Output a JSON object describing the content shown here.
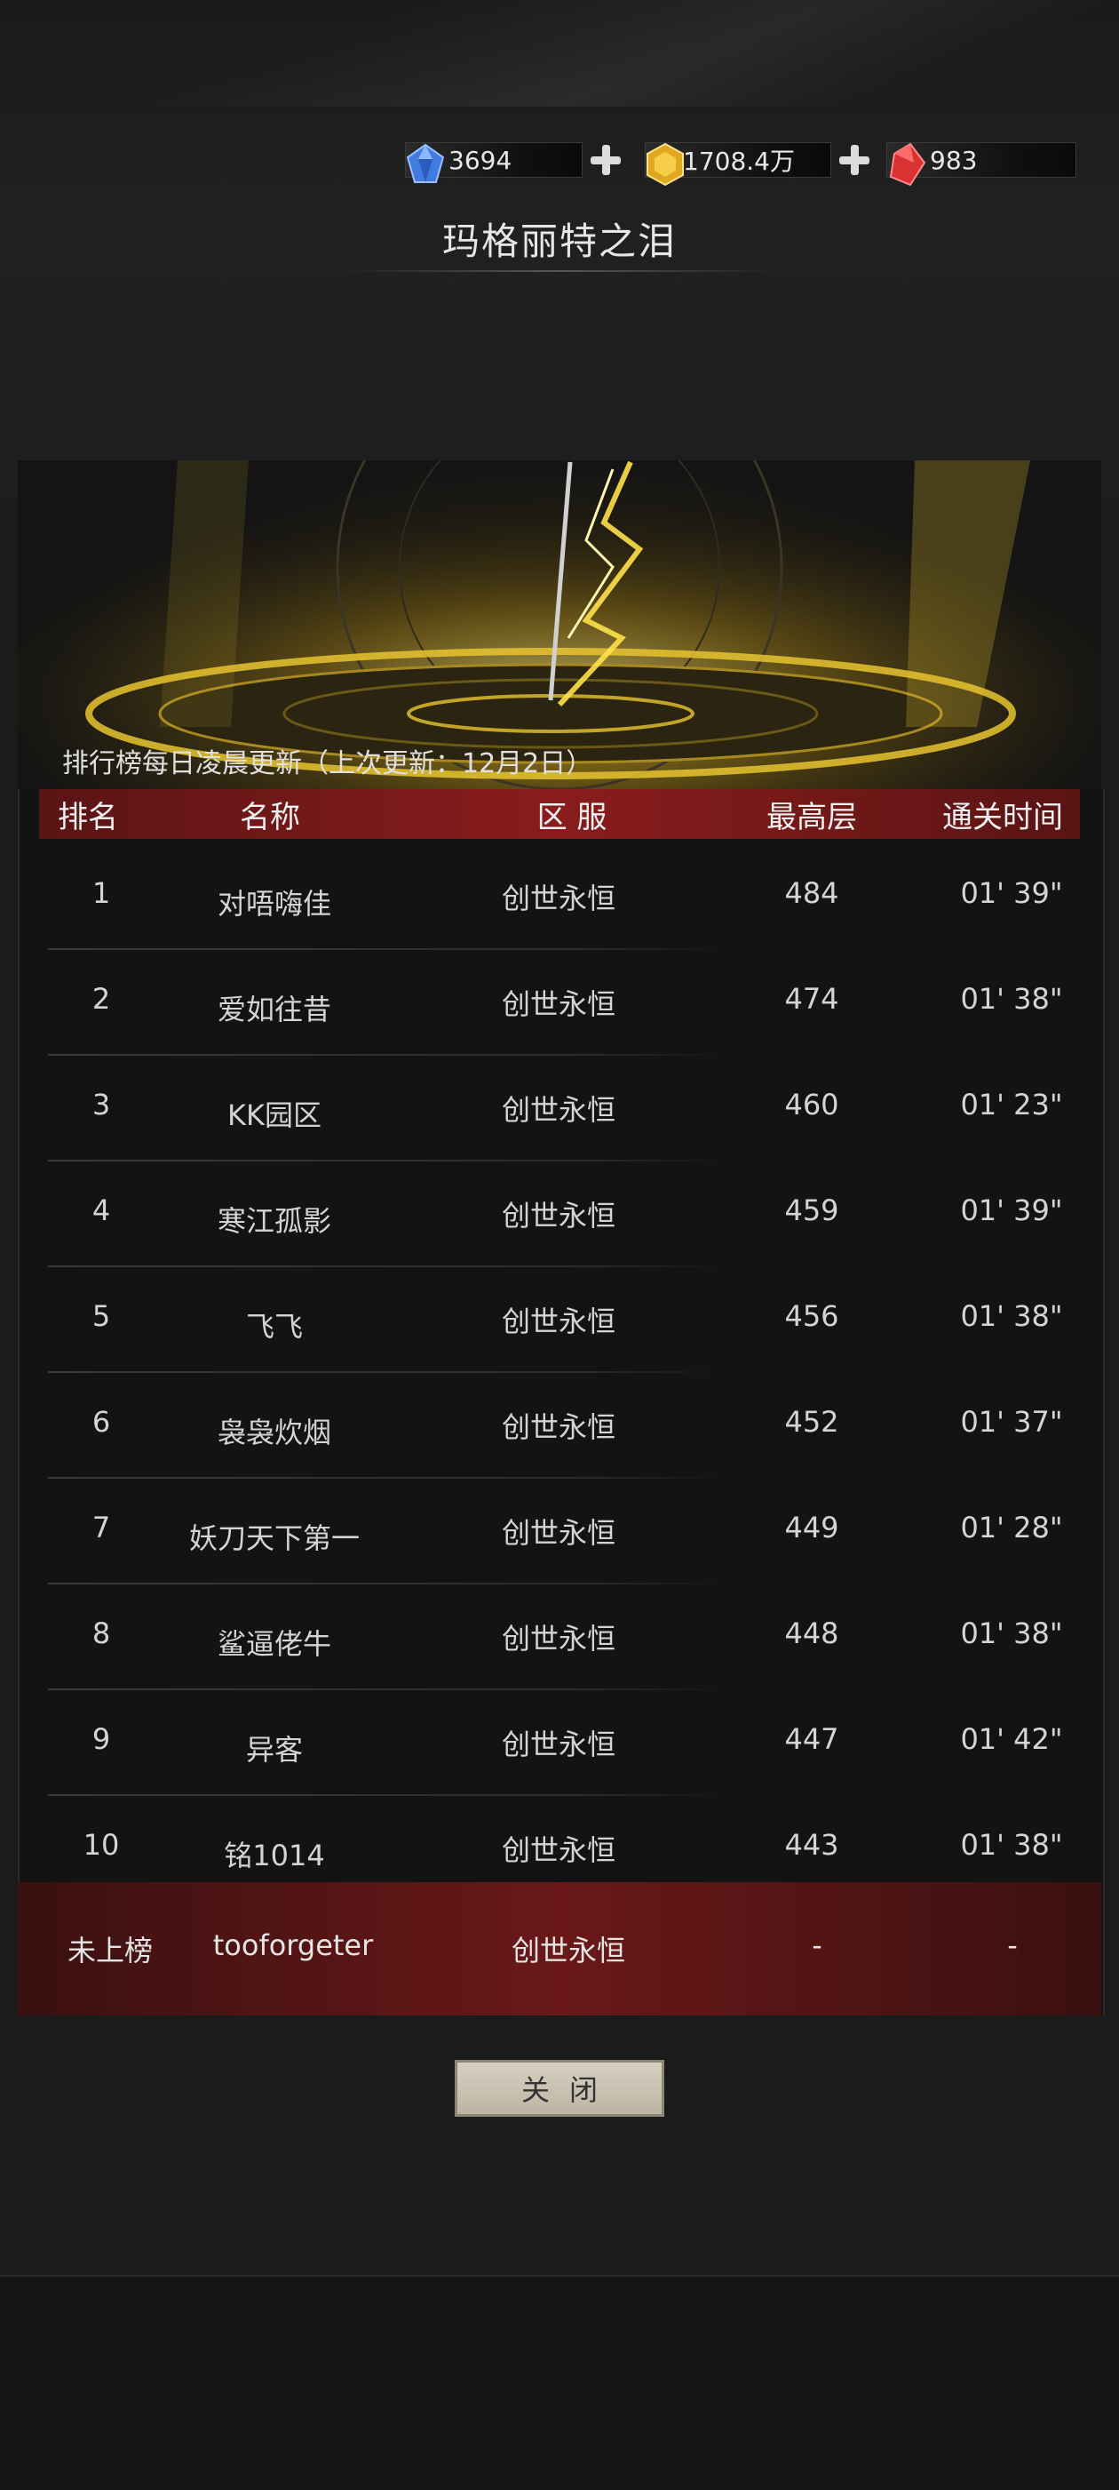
{
  "currencies": [
    {
      "icon": "blue-diamond-icon",
      "value": "3694",
      "color": "#3f7be0"
    },
    {
      "icon": "gold-coin-icon",
      "value": "1708.4万",
      "color": "#e0a820"
    },
    {
      "icon": "red-gem-icon",
      "value": "983",
      "color": "#d83232"
    }
  ],
  "title": "玛格丽特之泪",
  "update_note": "排行榜每日凌晨更新（上次更新：12月2日）",
  "columns": [
    "排名",
    "名称",
    "区 服",
    "最高层",
    "通关时间"
  ],
  "rows": [
    {
      "rank": "1",
      "name": "对唔嗨佳",
      "server": "创世永恒",
      "floor": "484",
      "time": "01' 39\""
    },
    {
      "rank": "2",
      "name": "爱如往昔",
      "server": "创世永恒",
      "floor": "474",
      "time": "01' 38\""
    },
    {
      "rank": "3",
      "name": "KK园区",
      "server": "创世永恒",
      "floor": "460",
      "time": "01' 23\""
    },
    {
      "rank": "4",
      "name": "寒江孤影",
      "server": "创世永恒",
      "floor": "459",
      "time": "01' 39\""
    },
    {
      "rank": "5",
      "name": "飞飞",
      "server": "创世永恒",
      "floor": "456",
      "time": "01' 38\""
    },
    {
      "rank": "6",
      "name": "袅袅炊烟",
      "server": "创世永恒",
      "floor": "452",
      "time": "01' 37\""
    },
    {
      "rank": "7",
      "name": "妖刀天下第一",
      "server": "创世永恒",
      "floor": "449",
      "time": "01' 28\""
    },
    {
      "rank": "8",
      "name": "鲨逼佬牛",
      "server": "创世永恒",
      "floor": "448",
      "time": "01' 38\""
    },
    {
      "rank": "9",
      "name": "异客",
      "server": "创世永恒",
      "floor": "447",
      "time": "01' 42\""
    },
    {
      "rank": "10",
      "name": "铭1014",
      "server": "创世永恒",
      "floor": "443",
      "time": "01' 38\""
    }
  ],
  "my_entry": {
    "rank": "未上榜",
    "name": "tooforgeter",
    "server": "创世永恒",
    "floor": "-",
    "time": "-"
  },
  "close_label": "关闭",
  "accent_colors": {
    "header": "#8a1c1c",
    "gold": "#e8c430"
  }
}
